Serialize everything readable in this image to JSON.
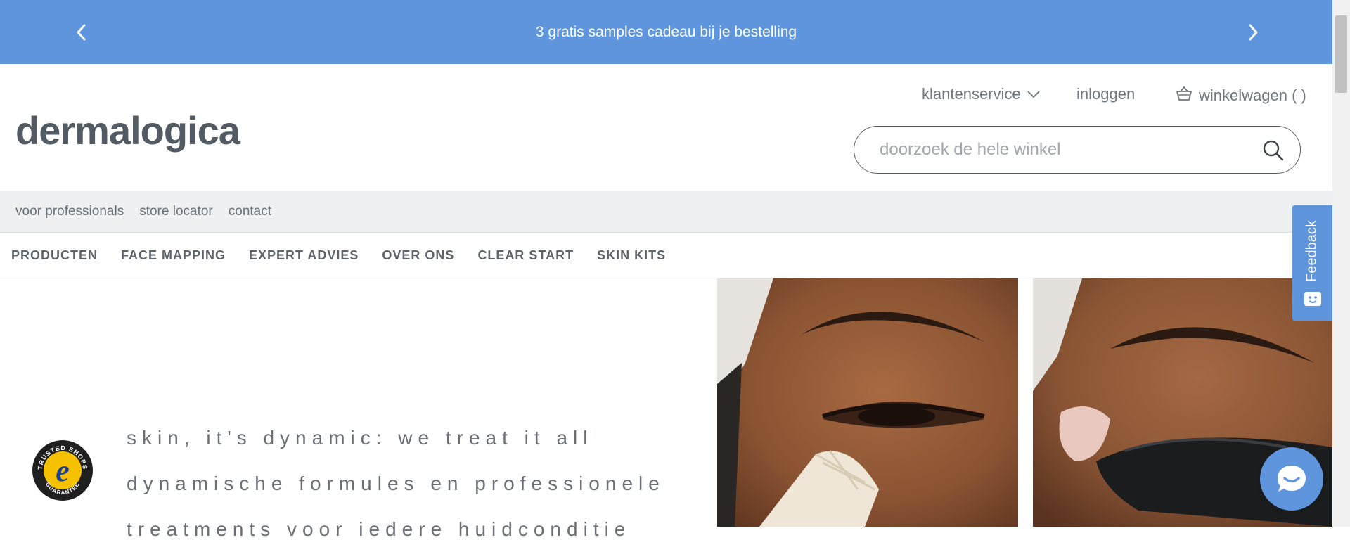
{
  "promo": {
    "text": "3 gratis samples cadeau bij je bestelling"
  },
  "header": {
    "logo": "dermalogica",
    "customer_service": "klantenservice",
    "login": "inloggen",
    "cart": "winkelwagen ( )",
    "search_placeholder": "doorzoek de hele winkel"
  },
  "subnav": {
    "items": [
      "voor professionals",
      "store locator",
      "contact"
    ]
  },
  "mainnav": {
    "items": [
      "PRODUCTEN",
      "FACE MAPPING",
      "EXPERT ADVIES",
      "OVER ONS",
      "CLEAR START",
      "SKIN KITS"
    ]
  },
  "hero": {
    "lines": [
      "skin, it's dynamic: we treat it all",
      "dynamische formules en professionele",
      "treatments voor iedere huidconditie"
    ]
  },
  "feedback": {
    "label": "Feedback"
  },
  "trusted": {
    "text": "TRUSTED SHOPS GUARANTEE"
  },
  "colors": {
    "accent": "#5f95dd",
    "text": "#4a5158"
  }
}
